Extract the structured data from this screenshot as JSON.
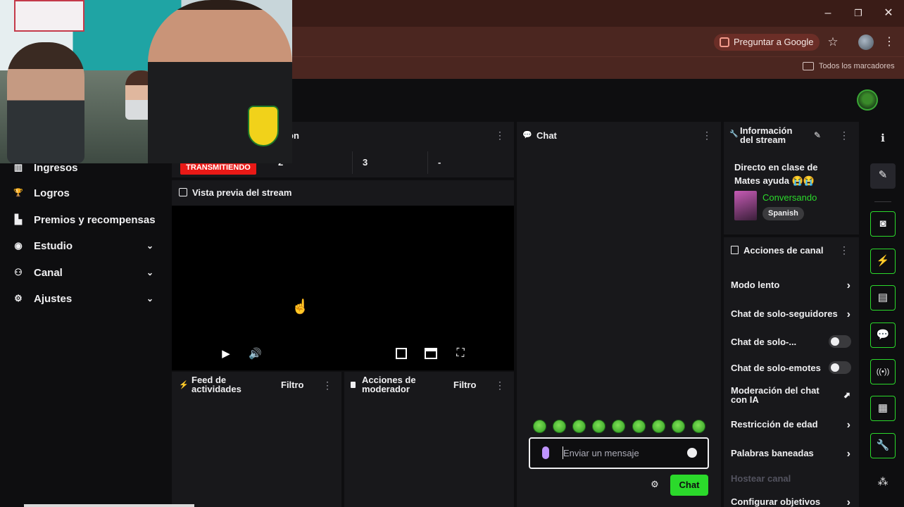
{
  "browser": {
    "google_chip": "Preguntar a Google",
    "bookmarks_label": "Todos los marcadores",
    "window_minimize": "–",
    "window_maximize": "❐",
    "window_close": "✕",
    "star_icon": "☆",
    "menu_icon": "⋮"
  },
  "sidebar": {
    "items": [
      {
        "label": "Ingresos",
        "icon": "income-icon",
        "glyph": "▥"
      },
      {
        "label": "Logros",
        "icon": "trophy-icon",
        "glyph": "🏆"
      },
      {
        "label": "Premios y recompensas",
        "icon": "gift-icon",
        "glyph": "▙"
      },
      {
        "label": "Estudio",
        "icon": "studio-icon",
        "glyph": "◉"
      },
      {
        "label": "Canal",
        "icon": "channel-icon",
        "glyph": "⚇"
      },
      {
        "label": "Ajustes",
        "icon": "settings-icon",
        "glyph": "⚙"
      }
    ],
    "chevron": "⌄"
  },
  "stats": {
    "title": "ón",
    "live_badge": "TRANSMITIENDO",
    "values": [
      "2",
      "3",
      "-"
    ]
  },
  "preview": {
    "title": "Vista previa del stream"
  },
  "feed": {
    "title_line1": "Feed de",
    "title_line2": "actividades",
    "filter": "Filtro"
  },
  "moderator": {
    "title_line1": "Acciones de",
    "title_line2": "moderador",
    "filter": "Filtro"
  },
  "chat": {
    "title": "Chat",
    "placeholder": "Enviar un mensaje",
    "send_label": "Chat"
  },
  "stream_info": {
    "title_line1": "Información",
    "title_line2": "del stream",
    "stream_title_line1": "Directo en clase de",
    "stream_title_line2": "Mates ayuda 😭😭",
    "category": "Conversando",
    "language": "Spanish"
  },
  "channel_actions": {
    "title": "Acciones de canal",
    "items": [
      {
        "label": "Modo lento",
        "control": "arrow"
      },
      {
        "label": "Chat de solo-seguidores",
        "control": "arrow"
      },
      {
        "label": "Chat de solo-...",
        "control": "toggle"
      },
      {
        "label": "Chat de solo-emotes",
        "control": "toggle"
      },
      {
        "label_line1": "Moderación del chat",
        "label_line2": "con IA",
        "control": "chart"
      },
      {
        "label": "Restricción de edad",
        "control": "arrow"
      },
      {
        "label": "Palabras baneadas",
        "control": "arrow"
      },
      {
        "label": "Hostear canal",
        "control": "none"
      },
      {
        "label": "Configurar objetivos",
        "control": "arrow"
      }
    ]
  },
  "colors": {
    "accent": "#2bd92b",
    "live": "#e91916",
    "category": "#2bd92b"
  }
}
